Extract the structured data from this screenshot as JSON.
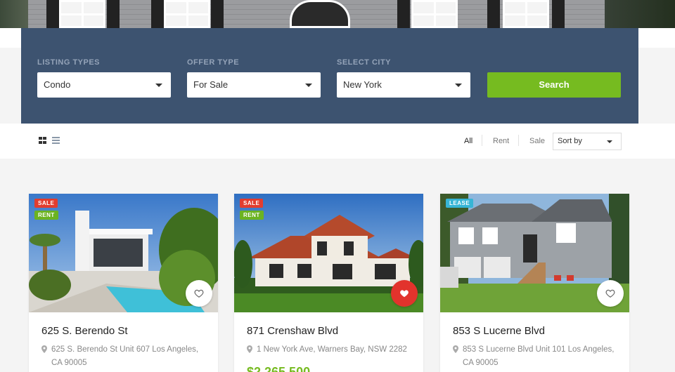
{
  "search": {
    "listing_types": {
      "label": "LISTING TYPES",
      "value": "Condo"
    },
    "offer_type": {
      "label": "OFFER TYPE",
      "value": "For Sale"
    },
    "select_city": {
      "label": "SELECT CITY",
      "value": "New York"
    },
    "button_label": "Search"
  },
  "toolbar": {
    "view_modes": [
      "grid-icon",
      "list-icon"
    ],
    "filters": [
      "All",
      "Rent",
      "Sale"
    ],
    "sort_placeholder": "Sort by"
  },
  "listings": [
    {
      "title": "625 S. Berendo St",
      "address": "625 S. Berendo St Unit 607 Los Angeles, CA 90005",
      "badges": [
        "SALE",
        "RENT"
      ],
      "favorited": false
    },
    {
      "title": "871 Crenshaw Blvd",
      "address": "1 New York Ave, Warners Bay, NSW 2282",
      "badges": [
        "SALE",
        "RENT"
      ],
      "favorited": true,
      "price": "$2,265,500"
    },
    {
      "title": "853 S Lucerne Blvd",
      "address": "853 S Lucerne Blvd Unit 101 Los Angeles, CA 90005",
      "badges": [
        "LEASE"
      ],
      "favorited": false
    }
  ],
  "colors": {
    "panel": "#3d5370",
    "accent_green": "#76bb20",
    "sale_red": "#e23d2f",
    "lease_blue": "#37b5d6"
  }
}
